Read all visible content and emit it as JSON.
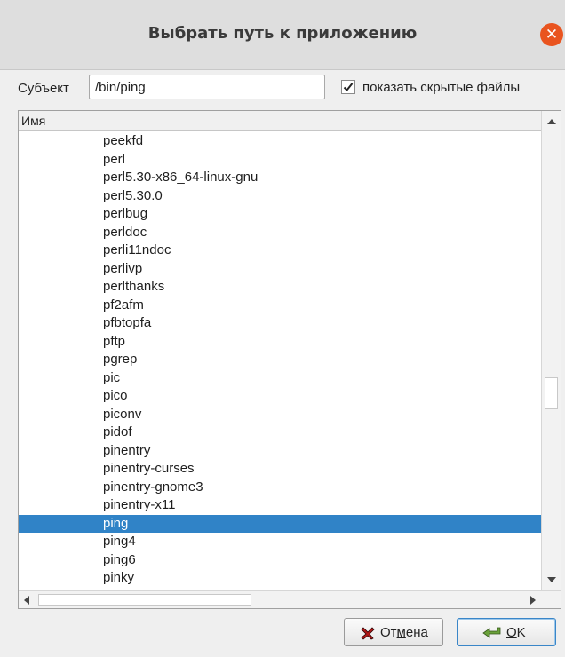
{
  "window": {
    "title": "Выбрать путь к приложению",
    "close_glyph": "✕"
  },
  "subject": {
    "label": "Субъект",
    "value": "/bin/ping",
    "show_hidden_checked": true,
    "show_hidden_label": "показать скрытые файлы"
  },
  "file_list": {
    "column_header": "Имя",
    "selected_item": "ping",
    "items": [
      "peekfd",
      "perl",
      "perl5.30-x86_64-linux-gnu",
      "perl5.30.0",
      "perlbug",
      "perldoc",
      "perli11ndoc",
      "perlivp",
      "perlthanks",
      "pf2afm",
      "pfbtopfa",
      "pftp",
      "pgrep",
      "pic",
      "pico",
      "piconv",
      "pidof",
      "pinentry",
      "pinentry-curses",
      "pinentry-gnome3",
      "pinentry-x11",
      "ping",
      "ping4",
      "ping6",
      "pinky"
    ]
  },
  "buttons": {
    "cancel": {
      "label_pre": "От",
      "label_mnemonic": "м",
      "label_post": "ена",
      "icon": "cancel-x-icon"
    },
    "ok": {
      "label_pre": "",
      "label_mnemonic": "O",
      "label_post": "K",
      "icon": "ok-arrow-icon"
    }
  },
  "colors": {
    "selection": "#3083c7",
    "close_button": "#e9541f"
  }
}
